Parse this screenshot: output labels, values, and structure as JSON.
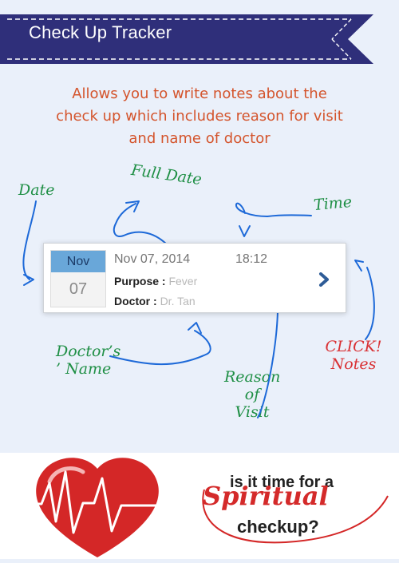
{
  "banner": {
    "title": "Check Up Tracker"
  },
  "intro": {
    "lines": [
      "Allows you to write notes about the",
      "check up which includes reason for visit",
      "and name of doctor"
    ]
  },
  "annotations": {
    "date": "Date",
    "full_date": "Full Date",
    "time": "Time",
    "doctor_name_1": "Doctor’s",
    "doctor_name_2": "’ Name",
    "reason_1": "Reason",
    "reason_2": "of",
    "reason_3": "Visit",
    "click_1": "CLICK!",
    "click_2": "Notes"
  },
  "card": {
    "month": "Nov",
    "day": "07",
    "full_date": "Nov 07, 2014",
    "time": "18:12",
    "purpose_label": "Purpose :",
    "purpose_value": "Fever",
    "doctor_label": "Doctor :",
    "doctor_value": "Dr. Tan"
  },
  "footer": {
    "line1": "is it time for a",
    "line2": "Spiritual",
    "line3": "checkup?"
  },
  "colors": {
    "banner": "#2f2f7a",
    "intro_text": "#d4542c",
    "annotation_green": "#1f8f45",
    "annotation_red": "#d93134",
    "arrow_blue": "#1d69d8",
    "month_blue": "#69a7d9"
  }
}
